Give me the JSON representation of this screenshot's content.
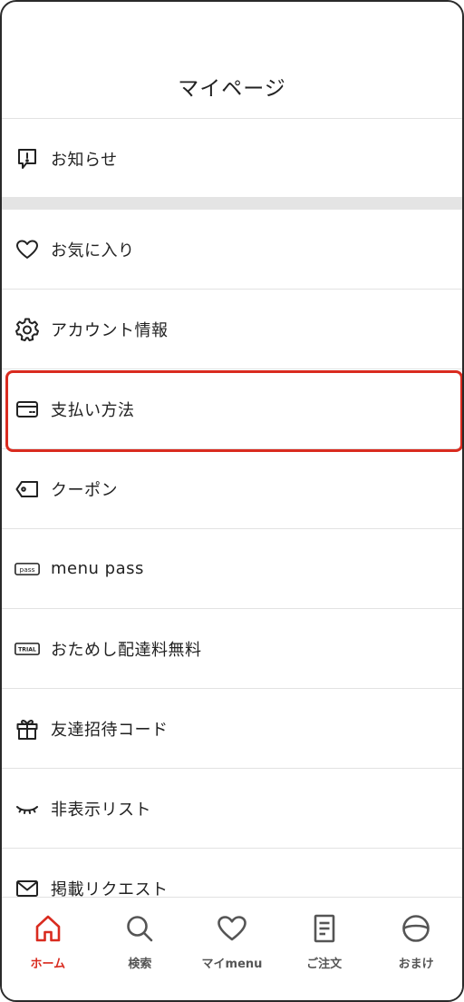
{
  "header": {
    "title": "マイページ"
  },
  "menu": [
    {
      "key": "notices",
      "label": "お知らせ",
      "icon": "notice-icon"
    },
    {
      "key": "favorites",
      "label": "お気に入り",
      "icon": "heart-icon"
    },
    {
      "key": "account",
      "label": "アカウント情報",
      "icon": "gear-icon"
    },
    {
      "key": "payment",
      "label": "支払い方法",
      "icon": "credit-card-icon"
    },
    {
      "key": "coupon",
      "label": "クーポン",
      "icon": "tag-icon"
    },
    {
      "key": "menu_pass",
      "label": "menu pass",
      "icon": "pass-badge-icon",
      "badge_text": "pass"
    },
    {
      "key": "trial",
      "label": "おためし配達料無料",
      "icon": "trial-badge-icon",
      "badge_text": "TRIAL"
    },
    {
      "key": "invite",
      "label": "友達招待コード",
      "icon": "gift-icon"
    },
    {
      "key": "hidden_list",
      "label": "非表示リスト",
      "icon": "closed-eye-icon"
    },
    {
      "key": "listing_request",
      "label": "掲載リクエスト",
      "icon": "mail-icon"
    }
  ],
  "tabbar": [
    {
      "key": "home",
      "label": "ホーム",
      "icon": "home-icon",
      "active": true
    },
    {
      "key": "search",
      "label": "検索",
      "icon": "search-icon",
      "active": false
    },
    {
      "key": "my_menu",
      "label": "マイmenu",
      "icon": "heart-icon",
      "active": false
    },
    {
      "key": "orders",
      "label": "ご注文",
      "icon": "document-icon",
      "active": false
    },
    {
      "key": "extras",
      "label": "おまけ",
      "icon": "circle-icon",
      "active": false
    }
  ],
  "colors": {
    "accent": "#d92b1f",
    "divider": "#e2e2e2",
    "text": "#222222",
    "tab_inactive": "#555555"
  },
  "highlighted_item": "payment"
}
